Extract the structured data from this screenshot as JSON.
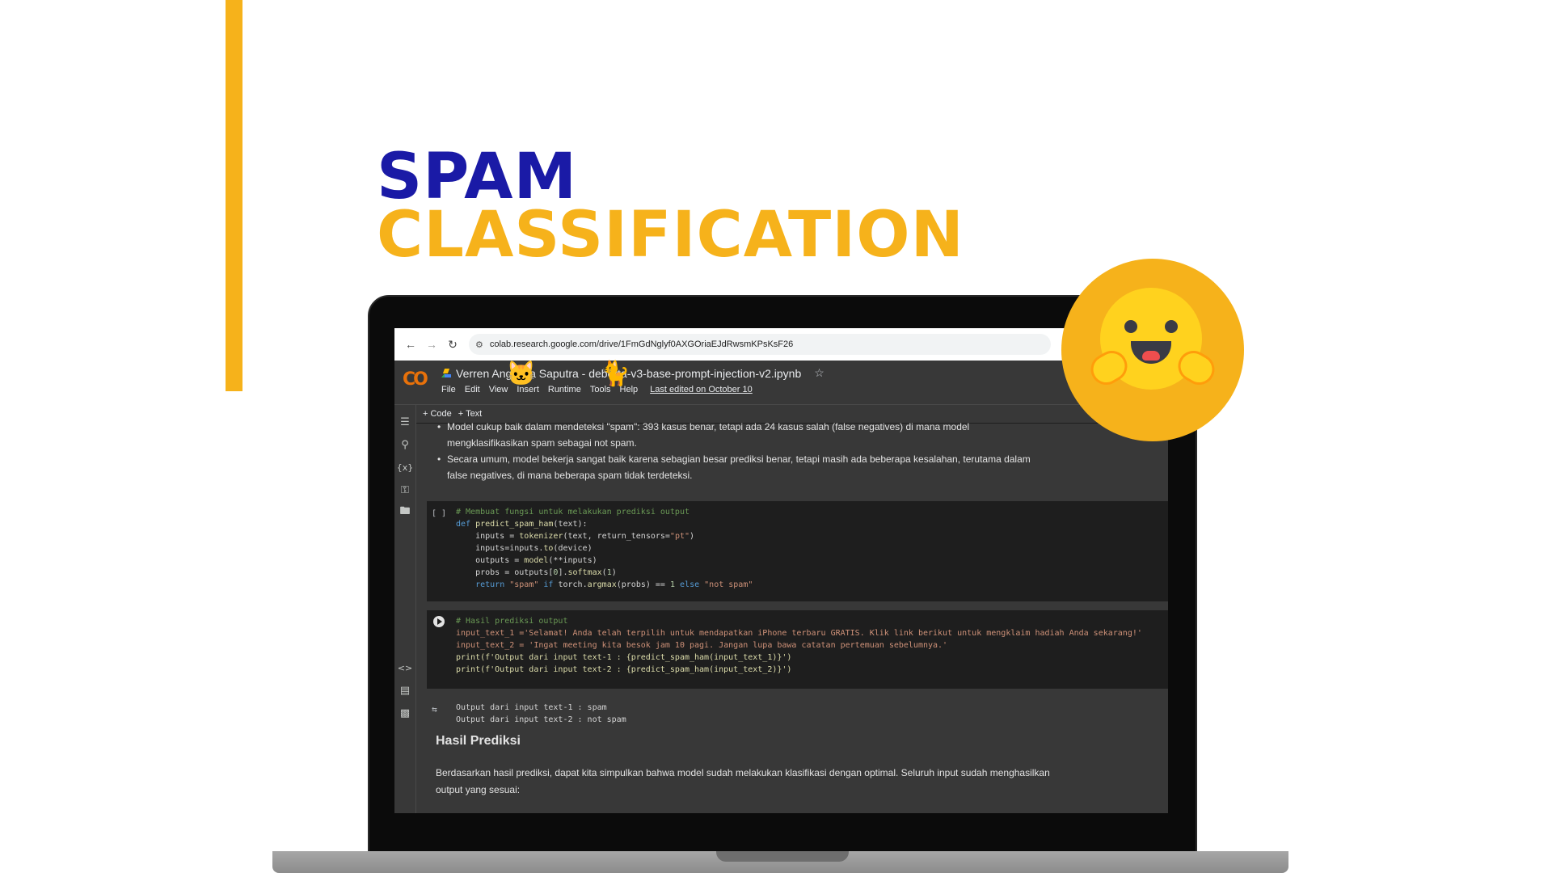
{
  "slide": {
    "title_line1": "SPAM",
    "title_line2": "CLASSIFICATION",
    "colors": {
      "accent": "#f6b21b",
      "title_blue": "#1a1aa6"
    }
  },
  "browser": {
    "url": "colab.research.google.com/drive/1FmGdNglyf0AXGOriaEJdRwsmKPsKsF26",
    "icons": [
      "back-arrow-icon",
      "forward-arrow-icon",
      "reload-icon",
      "site-settings-icon"
    ]
  },
  "colab": {
    "logo": "CO",
    "notebook_title": "Verren Angelina Saputra - deberta-v3-base-prompt-injection-v2.ipynb",
    "menu": [
      "File",
      "Edit",
      "View",
      "Insert",
      "Runtime",
      "Tools",
      "Help"
    ],
    "last_edited": "Last edited on October 10",
    "toolbar": {
      "add_code": "+ Code",
      "add_text": "+ Text"
    },
    "sidebar_icons": [
      "table-of-contents-icon",
      "search-icon",
      "variables-icon",
      "secrets-key-icon",
      "files-folder-icon",
      "code-snippets-icon",
      "command-palette-icon",
      "terminal-icon"
    ]
  },
  "notebook": {
    "bullets": [
      "Model cukup baik dalam mendeteksi \"spam\": 393 kasus benar, tetapi ada 24 kasus salah (false negatives) di mana model",
      "mengklasifikasikan spam sebagai not spam.",
      "Secara umum, model bekerja sangat baik karena sebagian besar prediksi benar, tetapi masih ada beberapa kesalahan, terutama dalam",
      "false negatives, di mana beberapa spam tidak terdeteksi."
    ],
    "cell1_brackets": "[ ]",
    "cell1": [
      "# Membuat fungsi untuk melakukan prediksi output",
      "def predict_spam_ham(text):",
      "    inputs = tokenizer(text, return_tensors=\"pt\")",
      "    inputs=inputs.to(device)",
      "    outputs = model(**inputs)",
      "    probs = outputs[0].softmax(1)",
      "    return \"spam\" if torch.argmax(probs) == 1 else \"not spam\""
    ],
    "cell2": [
      "# Hasil prediksi output",
      "input_text_1 ='Selamat! Anda telah terpilih untuk mendapatkan iPhone terbaru GRATIS. Klik link berikut untuk mengklaim hadiah Anda sekarang!'",
      "input_text_2 = 'Ingat meeting kita besok jam 10 pagi. Jangan lupa bawa catatan pertemuan sebelumnya.'",
      "print(f'Output dari input text-1 : {predict_spam_ham(input_text_1)}')",
      "print(f'Output dari input text-2 : {predict_spam_ham(input_text_2)}')"
    ],
    "output": [
      "Output dari input text-1 : spam",
      "Output dari input text-2 : not spam"
    ],
    "heading": "Hasil Prediksi",
    "paragraph_line1": "Berdasarkan hasil prediksi, dapat kita simpulkan bahwa model sudah melakukan klasifikasi dengan optimal. Seluruh input sudah menghasilkan",
    "paragraph_line2": "output yang sesuai:"
  },
  "logo": {
    "name": "hugging-face-logo"
  }
}
